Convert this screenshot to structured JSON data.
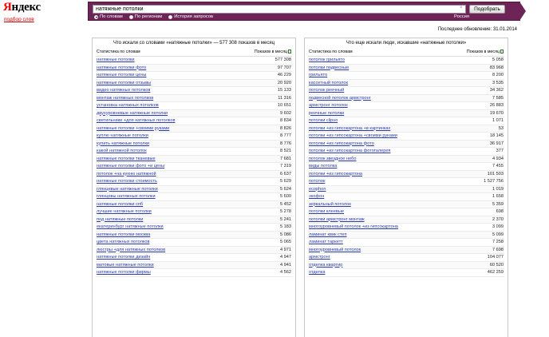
{
  "logo": {
    "first": "Я",
    "rest": "ндекс"
  },
  "subtitle": "подбор слов",
  "search": {
    "value": "натяжные потолки",
    "clear": "×",
    "submit": "Подобрать",
    "options": [
      {
        "label": "По словам",
        "checked": true
      },
      {
        "label": "По регионам",
        "checked": false
      },
      {
        "label": "История запросов",
        "checked": false
      }
    ],
    "region": "Россия"
  },
  "last_update": "Последнее обновление: 31.01.2014",
  "left": {
    "title": "Что искали со словами «натяжные потолки» — 577 308 показов в месяц",
    "col_word": "Статистика по словам",
    "col_count": "Показов в месяц",
    "rows": [
      [
        "натяжные потолки",
        "577 308"
      ],
      [
        "натяжные потолки фото",
        "97 707"
      ],
      [
        "натяжные потолки цены",
        "46 229"
      ],
      [
        "натяжные потолки отзывы",
        "20 920"
      ],
      [
        "видео натяжных потолков",
        "15 133"
      ],
      [
        "монтаж натяжных потолков",
        "11 316"
      ],
      [
        "установка натяжных потолков",
        "10 651"
      ],
      [
        "двухуровневые натяжные потолки",
        "9 602"
      ],
      [
        "светильники +для натяжных потолков",
        "8 834"
      ],
      [
        "натяжные потолки +своими руками",
        "8 826"
      ],
      [
        "куплю натяжные потолки",
        "8 777"
      ],
      [
        "купить натяжные потолки",
        "8 776"
      ],
      [
        "какой натяжной потолок",
        "8 521"
      ],
      [
        "натяжные потолки тканевые",
        "7 681"
      ],
      [
        "натяжные потолки фото +и цены",
        "7 319"
      ],
      [
        "потолок +на кухню натяжной",
        "6 637"
      ],
      [
        "натяжные потолки стоимость",
        "5 629"
      ],
      [
        "глянцевые натяжные потолки",
        "5 624"
      ],
      [
        "глянцевы натяжные потолки",
        "5 600"
      ],
      [
        "натяжные потолки спб",
        "5 452"
      ],
      [
        "лучшие натяжные потолки",
        "5 278"
      ],
      [
        "под натяжные потолки",
        "5 241"
      ],
      [
        "екатеринбург натяжные потолки",
        "5 183"
      ],
      [
        "натяжные потолки москва",
        "5 086"
      ],
      [
        "цвета натяжных потолков",
        "5 065"
      ],
      [
        "люстры +для натяжных потолков",
        "4 971"
      ],
      [
        "натяжные потолки дизайн",
        "4 947"
      ],
      [
        "матовые натяжные потолки",
        "4 941"
      ],
      [
        "натяжные потолки фирмы",
        "4 562"
      ]
    ]
  },
  "right": {
    "title": "Что еще искали люди, искавшие «натяжные потолки»",
    "col_word": "Статистика по словам",
    "col_count": "Показов в месяц",
    "rows": [
      [
        "потолок грильято",
        "5 058"
      ],
      [
        "потолки подвесные",
        "83 968"
      ],
      [
        "грильято",
        "8 200"
      ],
      [
        "кассетный потолок",
        "3 535"
      ],
      [
        "потолок реечный",
        "34 362"
      ],
      [
        "подвесной потолок армстронг",
        "7 585"
      ],
      [
        "армстронг потолок",
        "26 883"
      ],
      [
        "реечные потолки",
        "19 670"
      ],
      [
        "потолки clipso",
        "1 071"
      ],
      [
        "потолки +из гипсокартона +в картинках",
        "53"
      ],
      [
        "потолки +из гипсокартона +своими руками",
        "18 145"
      ],
      [
        "потолки +из гипсокартона фото",
        "36 917"
      ],
      [
        "потолки +из гипсокартона фотогалерея",
        "377"
      ],
      [
        "потолок звездное небо",
        "4 934"
      ],
      [
        "виды потолка",
        "7 455"
      ],
      [
        "потолки +из гипсокартона",
        "101 503"
      ],
      [
        "потолок",
        "1 527 756"
      ],
      [
        "ecophon",
        "1 019"
      ],
      [
        "экофон",
        "1 658"
      ],
      [
        "зеркальный потолок",
        "5 359"
      ],
      [
        "потолки клеевые",
        "698"
      ],
      [
        "потолки армстронг монтаж",
        "2 370"
      ],
      [
        "многоуровневый потолок +из гипсокартона",
        "3 099"
      ],
      [
        "ламинат квик степ",
        "5 099"
      ],
      [
        "ламинат таркетт",
        "7 258"
      ],
      [
        "многоуровневый потолок",
        "7 698"
      ],
      [
        "армстронг",
        "104 077"
      ],
      [
        "отделка квартир",
        "60 520"
      ],
      [
        "отделка",
        "462 259"
      ]
    ]
  }
}
